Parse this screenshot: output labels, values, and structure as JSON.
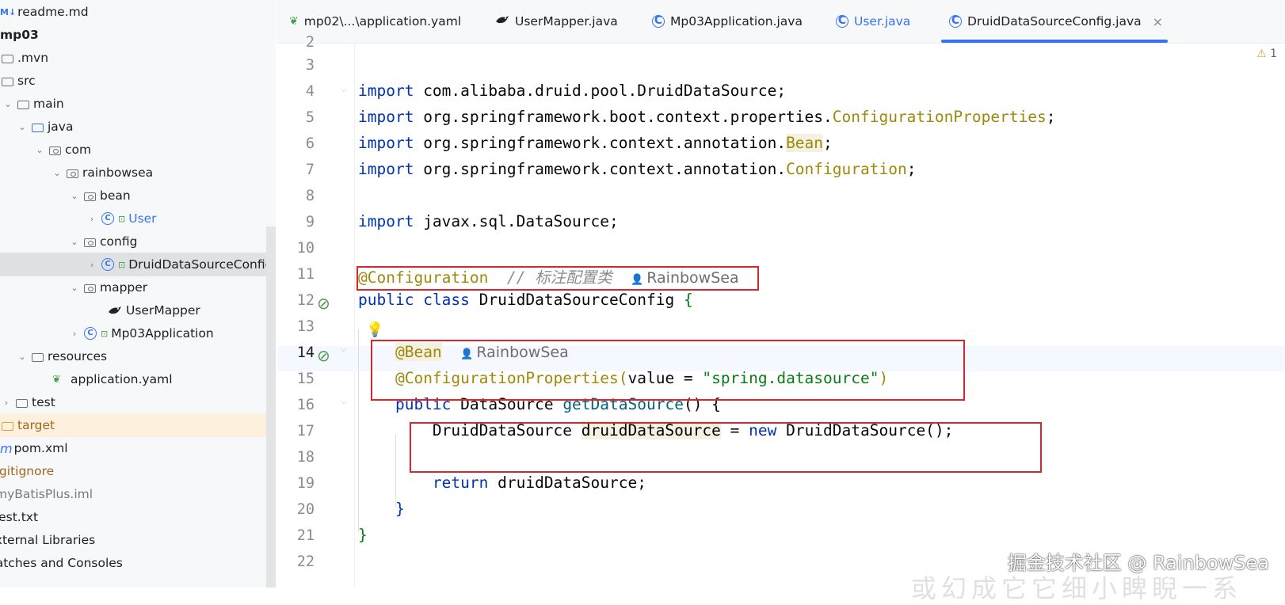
{
  "sidebar": {
    "items": [
      {
        "label": "readme.md",
        "prefix": "M↓"
      },
      {
        "label": "mp03"
      },
      {
        "label": ".mvn"
      },
      {
        "label": "src"
      },
      {
        "label": "main"
      },
      {
        "label": "java"
      },
      {
        "label": "com"
      },
      {
        "label": "rainbowsea"
      },
      {
        "label": "bean"
      },
      {
        "label": "User"
      },
      {
        "label": "config"
      },
      {
        "label": "DruidDataSourceConfig"
      },
      {
        "label": "mapper"
      },
      {
        "label": "UserMapper"
      },
      {
        "label": "Mp03Application"
      },
      {
        "label": "resources"
      },
      {
        "label": "application.yaml"
      },
      {
        "label": "test"
      },
      {
        "label": "target"
      },
      {
        "label": "pom.xml",
        "prefix": "m"
      },
      {
        "label": ".gitignore"
      },
      {
        "label": "myBatisPlus.iml"
      },
      {
        "label": "test.txt"
      },
      {
        "label": "External Libraries"
      },
      {
        "label": "Scratches and Consoles"
      }
    ]
  },
  "tabs": [
    {
      "label": "mp02\\...\\application.yaml"
    },
    {
      "label": "UserMapper.java"
    },
    {
      "label": "Mp03Application.java"
    },
    {
      "label": "User.java"
    },
    {
      "label": "DruidDataSourceConfig.java",
      "close": "×"
    }
  ],
  "warnings": {
    "count": "1"
  },
  "editor": {
    "line_numbers": [
      "2",
      "3",
      "4",
      "5",
      "6",
      "7",
      "8",
      "9",
      "10",
      "11",
      "12",
      "13",
      "14",
      "15",
      "16",
      "17",
      "18",
      "19",
      "20",
      "21",
      "22"
    ],
    "l4": {
      "kw": "import",
      "rest": " com.alibaba.druid.pool.DruidDataSource;"
    },
    "l5": {
      "kw": "import",
      "pre": " org.springframework.boot.context.properties.",
      "ann": "ConfigurationProperties",
      "end": ";"
    },
    "l6": {
      "kw": "import",
      "pre": " org.springframework.context.annotation.",
      "ann": "Bean",
      "end": ";"
    },
    "l7": {
      "kw": "import",
      "pre": " org.springframework.context.annotation.",
      "ann": "Configuration",
      "end": ";"
    },
    "l9": {
      "kw": "import",
      "rest": " javax.sql.DataSource;"
    },
    "l11": {
      "ann": "@Configuration",
      "comment": "  // 标注配置类",
      "author": "RainbowSea"
    },
    "l12": {
      "kw1": "public",
      "kw2": "class",
      "name": " DruidDataSourceConfig ",
      "brace": "{"
    },
    "l14": {
      "ann": "@Bean",
      "author": "RainbowSea"
    },
    "l15": {
      "ann": "@ConfigurationProperties",
      "open": "(",
      "param": "value",
      "eq": " = ",
      "str": "\"spring.datasource\"",
      "close": ")"
    },
    "l16": {
      "kw": "public",
      "type": " DataSource ",
      "fn": "getDataSource",
      "rest": "() {"
    },
    "l17": {
      "type": "DruidDataSource ",
      "var": "druidDataSource",
      "eq": " = ",
      "kw": "new",
      "rest": " DruidDataSource();"
    },
    "l19": {
      "kw": "return",
      "rest": " druidDataSource;"
    },
    "l20": {
      "text": "}"
    },
    "l21": {
      "text": "}"
    }
  },
  "watermark": {
    "text": "掘金技术社区 @ RainbowSea",
    "text2": "或幻成它它细小睥睨一系"
  }
}
